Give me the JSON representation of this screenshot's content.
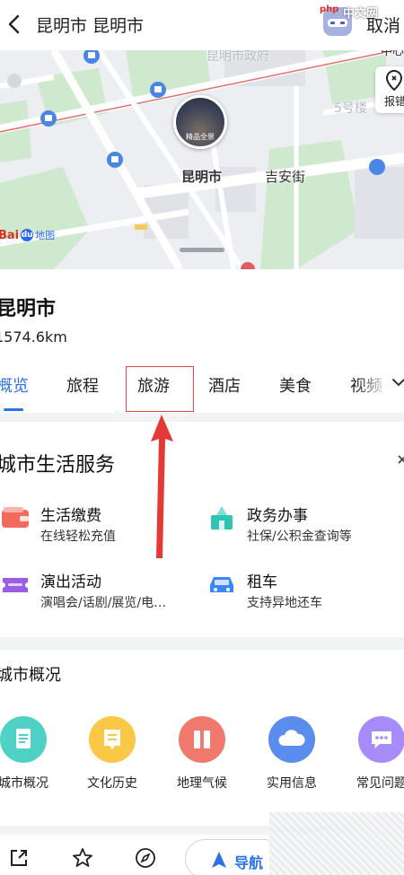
{
  "header": {
    "title": "昆明市 昆明市",
    "cancel_label": "取消",
    "watermark": "中文网",
    "logo_text": "php"
  },
  "map": {
    "labels": {
      "government": "昆明市政府",
      "building5": "5号楼",
      "street": "吉安街",
      "center": "昆明市",
      "zhong": "中心"
    },
    "photo_caption": "精品全景",
    "report_label": "报错",
    "baidu_text": "Bai",
    "baidu_map": "地图"
  },
  "place": {
    "name": "昆明市",
    "distance": "1574.6km"
  },
  "tabs": [
    {
      "label": "概览",
      "active": true
    },
    {
      "label": "旅程",
      "active": false
    },
    {
      "label": "旅游",
      "active": false
    },
    {
      "label": "酒店",
      "active": false
    },
    {
      "label": "美食",
      "active": false
    },
    {
      "label": "视频",
      "active": false
    }
  ],
  "services": {
    "title": "城市生活服务",
    "items": [
      {
        "name": "生活缴费",
        "desc": "在线轻松充值",
        "icon": "wallet-icon",
        "color": "#f26a5b"
      },
      {
        "name": "政务办事",
        "desc": "社保/公积金查询等",
        "icon": "government-building-icon",
        "color": "#2ec4b6"
      },
      {
        "name": "演出活动",
        "desc": "演唱会/话剧/展览/电…",
        "icon": "ticket-icon",
        "color": "#9b5de5"
      },
      {
        "name": "租车",
        "desc": "支持异地还车",
        "icon": "car-icon",
        "color": "#3a86ff"
      }
    ]
  },
  "overview": {
    "title": "城市概况",
    "items": [
      {
        "label": "城市概况",
        "icon": "document-icon",
        "color": "#4fd1c5"
      },
      {
        "label": "文化历史",
        "icon": "book-icon",
        "color": "#f9c846"
      },
      {
        "label": "地理气候",
        "icon": "pause-icon",
        "color": "#f0796e"
      },
      {
        "label": "实用信息",
        "icon": "cloud-icon",
        "color": "#5b8def"
      },
      {
        "label": "常见问题",
        "icon": "chat-icon",
        "color": "#a78bfa"
      }
    ]
  },
  "bottom": {
    "nav_label": "导航"
  },
  "colors": {
    "accent": "#2b72e8",
    "annotation": "#e2454a"
  }
}
